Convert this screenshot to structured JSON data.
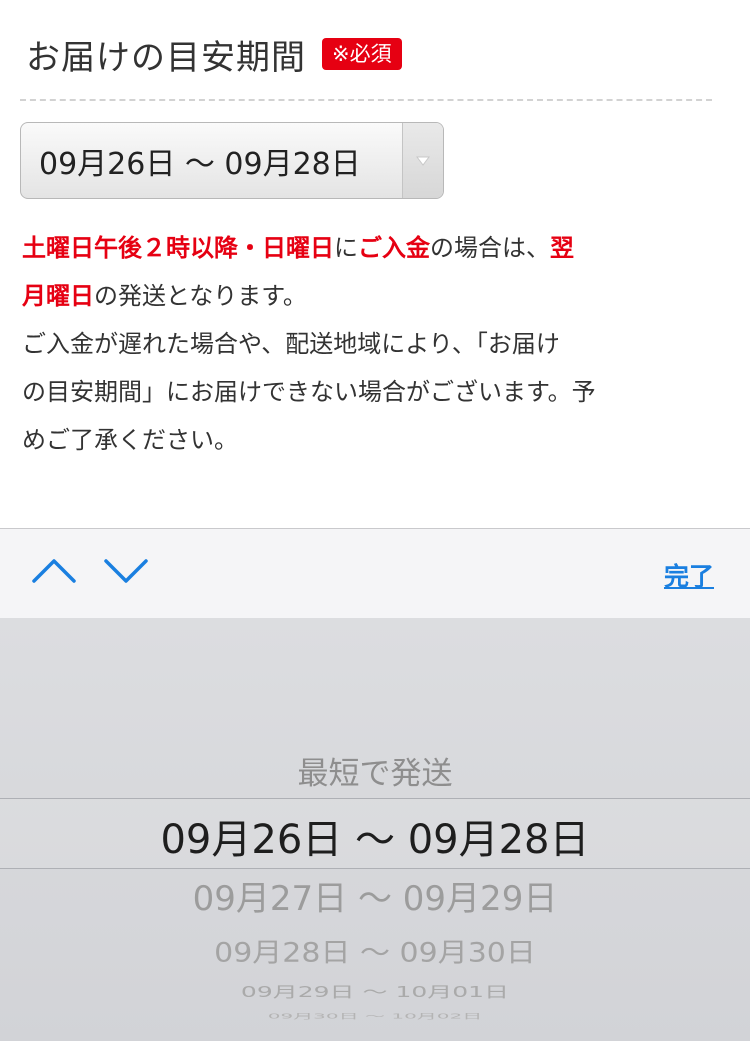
{
  "section": {
    "title": "お届けの目安期間",
    "required_badge": "※必須"
  },
  "date_select": {
    "value": "09月26日 〜 09月28日",
    "arrow_icon": "dropdown-triangle-icon"
  },
  "notice": {
    "line1_red": "土曜日午後２時以降・日曜日",
    "line1_mid": "に",
    "line1_red2": "ご入金",
    "line1_end": "の場合は、",
    "line1_red3": "翌",
    "line2_red": "月曜日",
    "line2_end": "の発送となります。",
    "line3": "ご入金が遅れた場合や、配送地域により、「お届け",
    "line4": "の目安期間」にお届けできない場合がございます。予",
    "line5": "めご了承ください。"
  },
  "toolbar": {
    "prev_icon": "chevron-up-icon",
    "next_icon": "chevron-down-icon",
    "done_label": "完了"
  },
  "picker": {
    "options": [
      "最短で発送",
      "09月26日 〜 09月28日",
      "09月27日 〜 09月29日",
      "09月28日 〜 09月30日",
      "09月29日 〜 10月01日",
      "09月30日 〜 10月02日"
    ],
    "selected_index": 1
  },
  "colors": {
    "required_red": "#e60012",
    "link_blue": "#1a7fe0",
    "text": "#333333"
  }
}
